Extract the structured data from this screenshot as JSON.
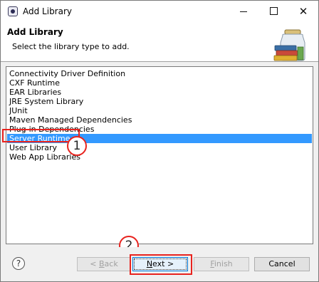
{
  "window": {
    "title": "Add Library",
    "minimize_icon": "minimize-icon",
    "maximize_icon": "maximize-icon",
    "close_icon": "close-icon"
  },
  "header": {
    "title": "Add Library",
    "description": "Select the library type to add."
  },
  "library_types": [
    {
      "label": "Connectivity Driver Definition",
      "selected": false
    },
    {
      "label": "CXF Runtime",
      "selected": false
    },
    {
      "label": "EAR Libraries",
      "selected": false
    },
    {
      "label": "JRE System Library",
      "selected": false
    },
    {
      "label": "JUnit",
      "selected": false
    },
    {
      "label": "Maven Managed Dependencies",
      "selected": false
    },
    {
      "label": "Plug-in Dependencies",
      "selected": false
    },
    {
      "label": "Server Runtime",
      "selected": true
    },
    {
      "label": "User Library",
      "selected": false
    },
    {
      "label": "Web App Libraries",
      "selected": false
    }
  ],
  "annotations": {
    "step1": "1",
    "step2": "2",
    "color": "#e8231e"
  },
  "buttons": {
    "help": "?",
    "back": {
      "mnemonic": "B",
      "rest": "ack",
      "prefix": "< ",
      "enabled": false
    },
    "next": {
      "mnemonic": "N",
      "rest": "ext >",
      "enabled": true
    },
    "finish": {
      "mnemonic": "F",
      "rest": "inish",
      "enabled": false
    },
    "cancel": {
      "label": "Cancel",
      "enabled": true
    }
  },
  "colors": {
    "selection": "#3399ff",
    "annotation": "#e8231e"
  }
}
